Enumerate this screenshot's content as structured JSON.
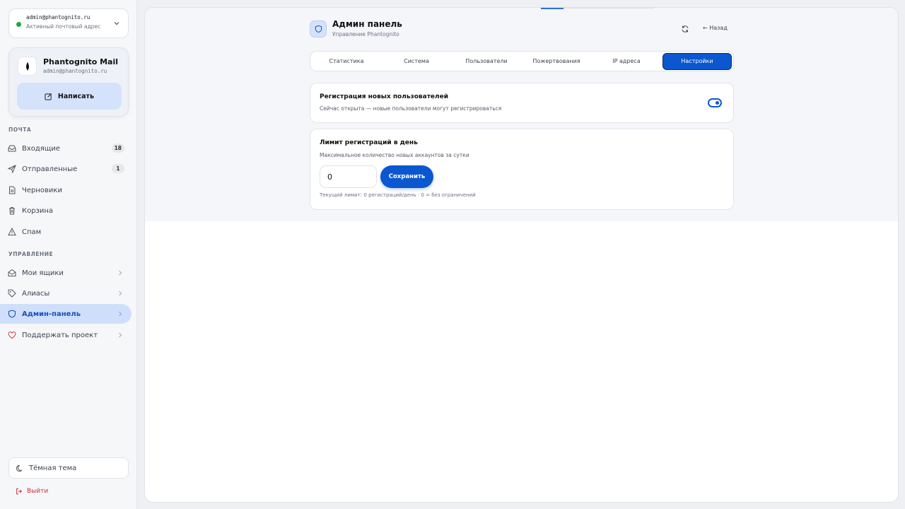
{
  "account": {
    "email": "admin@phantognito.ru",
    "status": "Активный почтовый адрес"
  },
  "profile": {
    "name": "Phantognito Mail",
    "email": "admin@phantognito.ru",
    "compose_label": "Написать"
  },
  "sidebar": {
    "mail_section": "ПОЧТА",
    "mail_items": [
      {
        "label": "Входящие",
        "badge": "18"
      },
      {
        "label": "Отправленные",
        "badge": "1"
      },
      {
        "label": "Черновики"
      },
      {
        "label": "Корзина"
      },
      {
        "label": "Спам"
      }
    ],
    "manage_section": "УПРАВЛЕНИЕ",
    "manage_items": [
      {
        "label": "Мои ящики"
      },
      {
        "label": "Алиасы"
      },
      {
        "label": "Админ-панель"
      },
      {
        "label": "Поддержать проект"
      }
    ],
    "theme_label": "Тёмная тема",
    "logout_label": "Выйти"
  },
  "header": {
    "title": "Админ панель",
    "subtitle": "Управление Phantognito",
    "back_label": "← Назад"
  },
  "tabs": [
    {
      "label": "Статистика"
    },
    {
      "label": "Система"
    },
    {
      "label": "Пользователи"
    },
    {
      "label": "Пожертвования"
    },
    {
      "label": "IP адреса"
    },
    {
      "label": "Настройки"
    }
  ],
  "registration": {
    "title": "Регистрация новых пользователей",
    "desc": "Сейчас открыта — новые пользователи могут регистрироваться",
    "enabled": true
  },
  "limit": {
    "title": "Лимит регистраций в день",
    "desc": "Максимальное количество новых аккаунтов за сутки",
    "value": "0",
    "save_label": "Сохранить",
    "note": "Текущий лимит: 0 регистраций/день · 0 = без ограничений"
  },
  "colors": {
    "accent": "#0b57d0",
    "active_nav_bg": "#cfdffb",
    "online_dot": "#22a447",
    "logout": "#c83232"
  }
}
